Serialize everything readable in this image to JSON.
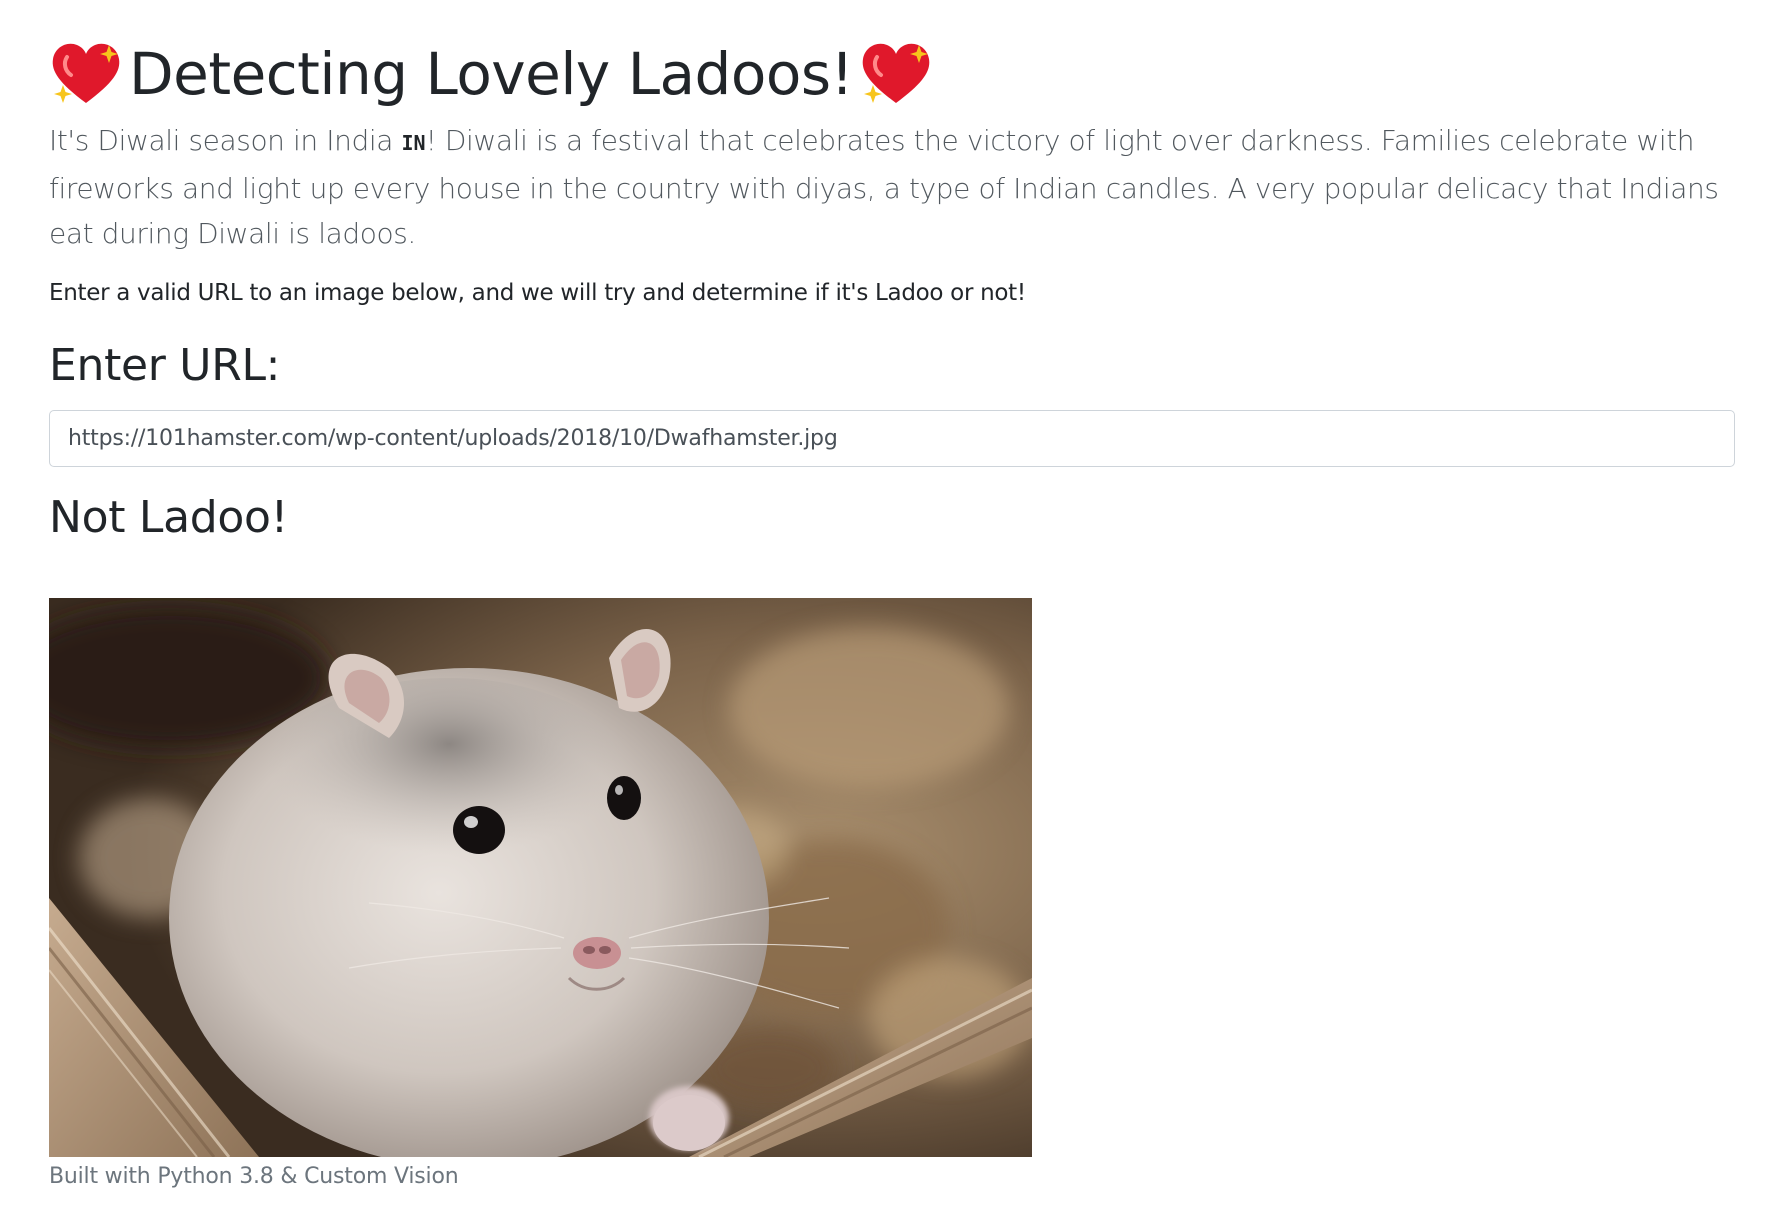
{
  "header": {
    "title": "Detecting Lovely Ladoos!",
    "title_icon": "sparkling-heart-icon"
  },
  "intro": {
    "text_before_flag": "It's Diwali season in India ",
    "flag_code": "IN",
    "text_after_flag": "! Diwali is a festival that celebrates the victory of light over darkness. Families celebrate with fireworks and light up every house in the country with diyas, a type of Indian candles. A very popular delicacy that Indians eat during Diwali is ladoos."
  },
  "instructions": "Enter a valid URL to an image below, and we will try and determine if it's Ladoo or not!",
  "url_section": {
    "heading": "Enter URL:",
    "input_value": "https://101hamster.com/wp-content/uploads/2018/10/Dwafhamster.jpg"
  },
  "result": {
    "heading": "Not Ladoo!",
    "image_subject": "hamster-photo"
  },
  "footer": {
    "note": "Built with Python 3.8 & Custom Vision"
  },
  "colors": {
    "heart": "#e0182b",
    "sparkle": "#f7c51c",
    "text": "#212529",
    "muted": "#6c757d"
  }
}
